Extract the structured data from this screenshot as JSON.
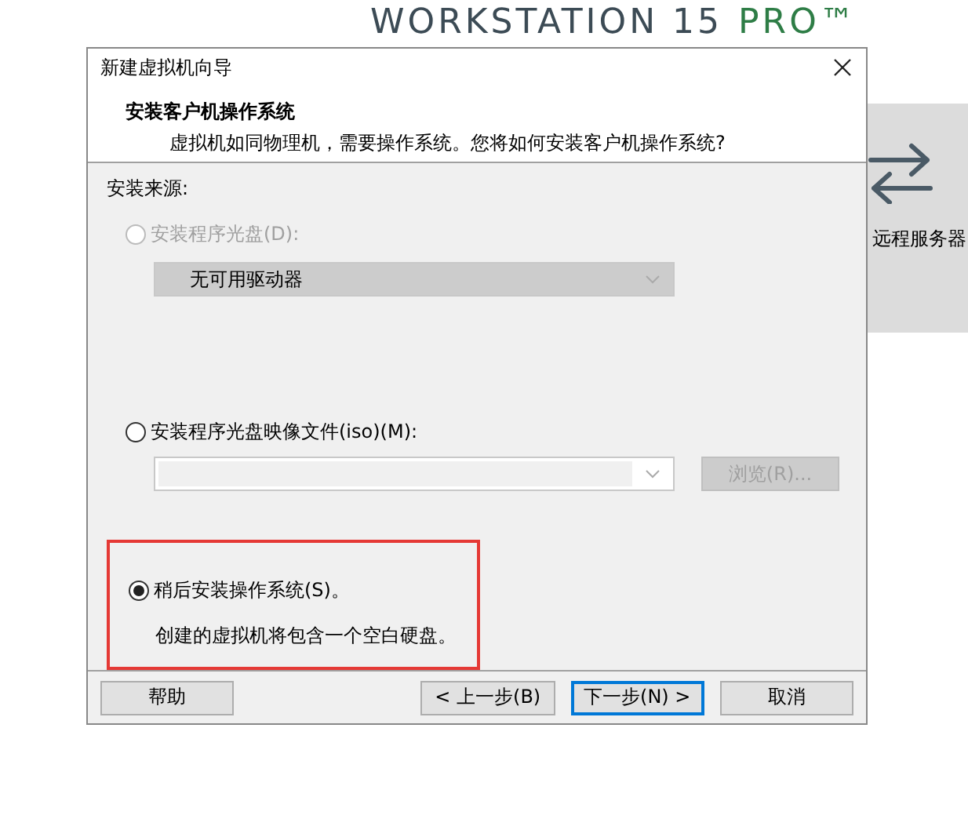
{
  "background": {
    "heading": "WORKSTATION 15",
    "heading_accent": "PRO™",
    "tile": {
      "label": "远程服务器"
    }
  },
  "dialog": {
    "title": "新建虚拟机向导",
    "header": {
      "title": "安装客户机操作系统",
      "subtitle": "虚拟机如同物理机，需要操作系统。您将如何安装客户机操作系统?"
    },
    "source_label": "安装来源:",
    "options": [
      {
        "kind": "drive",
        "label": "安装程序光盘(D):",
        "selected": false,
        "disabled": true,
        "combo_value": "无可用驱动器"
      },
      {
        "kind": "iso",
        "label": "安装程序光盘映像文件(iso)(M):",
        "selected": false,
        "disabled": false,
        "browse": "浏览(R)...",
        "browse_disabled": true
      },
      {
        "kind": "later",
        "label": "稍后安装操作系统(S)。",
        "selected": true,
        "disabled": false,
        "description": "创建的虚拟机将包含一个空白硬盘。",
        "highlighted": true
      }
    ],
    "buttons": [
      {
        "label": "帮助",
        "default": false
      },
      {
        "label": "< 上一步(B)",
        "default": false
      },
      {
        "label": "下一步(N) >",
        "default": true
      },
      {
        "label": "取消",
        "default": false
      }
    ]
  }
}
